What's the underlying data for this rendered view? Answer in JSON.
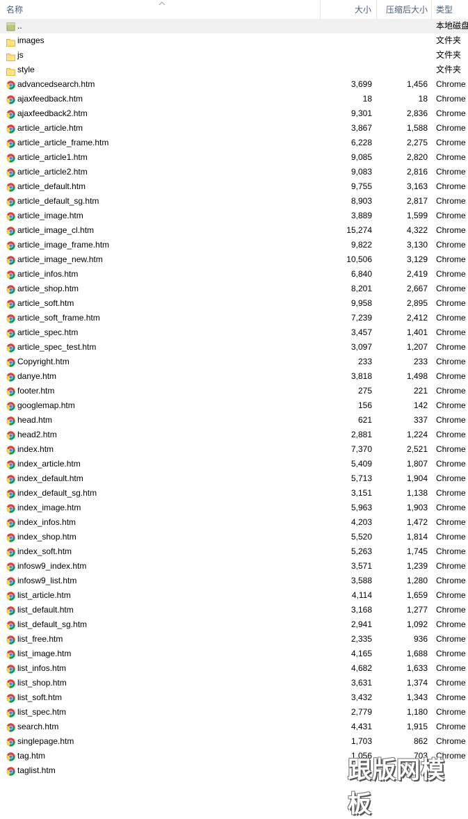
{
  "header": {
    "name": "名称",
    "size": "大小",
    "compressed": "压缩后大小",
    "type": "类型"
  },
  "rows": [
    {
      "kind": "parent",
      "name": "..",
      "size": "",
      "csize": "",
      "type": "本地磁盘"
    },
    {
      "kind": "folder",
      "name": "images",
      "size": "",
      "csize": "",
      "type": "文件夹"
    },
    {
      "kind": "folder",
      "name": "js",
      "size": "",
      "csize": "",
      "type": "文件夹"
    },
    {
      "kind": "folder",
      "name": "style",
      "size": "",
      "csize": "",
      "type": "文件夹"
    },
    {
      "kind": "file",
      "name": "advancedsearch.htm",
      "size": "3,699",
      "csize": "1,456",
      "type": "Chrome"
    },
    {
      "kind": "file",
      "name": "ajaxfeedback.htm",
      "size": "18",
      "csize": "18",
      "type": "Chrome"
    },
    {
      "kind": "file",
      "name": "ajaxfeedback2.htm",
      "size": "9,301",
      "csize": "2,836",
      "type": "Chrome"
    },
    {
      "kind": "file",
      "name": "article_article.htm",
      "size": "3,867",
      "csize": "1,588",
      "type": "Chrome"
    },
    {
      "kind": "file",
      "name": "article_article_frame.htm",
      "size": "6,228",
      "csize": "2,275",
      "type": "Chrome"
    },
    {
      "kind": "file",
      "name": "article_article1.htm",
      "size": "9,085",
      "csize": "2,820",
      "type": "Chrome"
    },
    {
      "kind": "file",
      "name": "article_article2.htm",
      "size": "9,083",
      "csize": "2,816",
      "type": "Chrome"
    },
    {
      "kind": "file",
      "name": "article_default.htm",
      "size": "9,755",
      "csize": "3,163",
      "type": "Chrome"
    },
    {
      "kind": "file",
      "name": "article_default_sg.htm",
      "size": "8,903",
      "csize": "2,817",
      "type": "Chrome"
    },
    {
      "kind": "file",
      "name": "article_image.htm",
      "size": "3,889",
      "csize": "1,599",
      "type": "Chrome"
    },
    {
      "kind": "file",
      "name": "article_image_cl.htm",
      "size": "15,274",
      "csize": "4,322",
      "type": "Chrome"
    },
    {
      "kind": "file",
      "name": "article_image_frame.htm",
      "size": "9,822",
      "csize": "3,130",
      "type": "Chrome"
    },
    {
      "kind": "file",
      "name": "article_image_new.htm",
      "size": "10,506",
      "csize": "3,129",
      "type": "Chrome"
    },
    {
      "kind": "file",
      "name": "article_infos.htm",
      "size": "6,840",
      "csize": "2,419",
      "type": "Chrome"
    },
    {
      "kind": "file",
      "name": "article_shop.htm",
      "size": "8,201",
      "csize": "2,667",
      "type": "Chrome"
    },
    {
      "kind": "file",
      "name": "article_soft.htm",
      "size": "9,958",
      "csize": "2,895",
      "type": "Chrome"
    },
    {
      "kind": "file",
      "name": "article_soft_frame.htm",
      "size": "7,239",
      "csize": "2,412",
      "type": "Chrome"
    },
    {
      "kind": "file",
      "name": "article_spec.htm",
      "size": "3,457",
      "csize": "1,401",
      "type": "Chrome"
    },
    {
      "kind": "file",
      "name": "article_spec_test.htm",
      "size": "3,097",
      "csize": "1,207",
      "type": "Chrome"
    },
    {
      "kind": "file",
      "name": "Copyright.htm",
      "size": "233",
      "csize": "233",
      "type": "Chrome"
    },
    {
      "kind": "file",
      "name": "danye.htm",
      "size": "3,818",
      "csize": "1,498",
      "type": "Chrome"
    },
    {
      "kind": "file",
      "name": "footer.htm",
      "size": "275",
      "csize": "221",
      "type": "Chrome"
    },
    {
      "kind": "file",
      "name": "googlemap.htm",
      "size": "156",
      "csize": "142",
      "type": "Chrome"
    },
    {
      "kind": "file",
      "name": "head.htm",
      "size": "621",
      "csize": "337",
      "type": "Chrome"
    },
    {
      "kind": "file",
      "name": "head2.htm",
      "size": "2,881",
      "csize": "1,224",
      "type": "Chrome"
    },
    {
      "kind": "file",
      "name": "index.htm",
      "size": "7,370",
      "csize": "2,521",
      "type": "Chrome"
    },
    {
      "kind": "file",
      "name": "index_article.htm",
      "size": "5,409",
      "csize": "1,807",
      "type": "Chrome"
    },
    {
      "kind": "file",
      "name": "index_default.htm",
      "size": "5,713",
      "csize": "1,904",
      "type": "Chrome"
    },
    {
      "kind": "file",
      "name": "index_default_sg.htm",
      "size": "3,151",
      "csize": "1,138",
      "type": "Chrome"
    },
    {
      "kind": "file",
      "name": "index_image.htm",
      "size": "5,963",
      "csize": "1,903",
      "type": "Chrome"
    },
    {
      "kind": "file",
      "name": "index_infos.htm",
      "size": "4,203",
      "csize": "1,472",
      "type": "Chrome"
    },
    {
      "kind": "file",
      "name": "index_shop.htm",
      "size": "5,520",
      "csize": "1,814",
      "type": "Chrome"
    },
    {
      "kind": "file",
      "name": "index_soft.htm",
      "size": "5,263",
      "csize": "1,745",
      "type": "Chrome"
    },
    {
      "kind": "file",
      "name": "infosw9_index.htm",
      "size": "3,571",
      "csize": "1,239",
      "type": "Chrome"
    },
    {
      "kind": "file",
      "name": "infosw9_list.htm",
      "size": "3,588",
      "csize": "1,280",
      "type": "Chrome"
    },
    {
      "kind": "file",
      "name": "list_article.htm",
      "size": "4,114",
      "csize": "1,659",
      "type": "Chrome"
    },
    {
      "kind": "file",
      "name": "list_default.htm",
      "size": "3,168",
      "csize": "1,277",
      "type": "Chrome"
    },
    {
      "kind": "file",
      "name": "list_default_sg.htm",
      "size": "2,941",
      "csize": "1,092",
      "type": "Chrome"
    },
    {
      "kind": "file",
      "name": "list_free.htm",
      "size": "2,335",
      "csize": "936",
      "type": "Chrome"
    },
    {
      "kind": "file",
      "name": "list_image.htm",
      "size": "4,165",
      "csize": "1,688",
      "type": "Chrome"
    },
    {
      "kind": "file",
      "name": "list_infos.htm",
      "size": "4,682",
      "csize": "1,633",
      "type": "Chrome"
    },
    {
      "kind": "file",
      "name": "list_shop.htm",
      "size": "3,631",
      "csize": "1,374",
      "type": "Chrome"
    },
    {
      "kind": "file",
      "name": "list_soft.htm",
      "size": "3,432",
      "csize": "1,343",
      "type": "Chrome"
    },
    {
      "kind": "file",
      "name": "list_spec.htm",
      "size": "2,779",
      "csize": "1,180",
      "type": "Chrome"
    },
    {
      "kind": "file",
      "name": "search.htm",
      "size": "4,431",
      "csize": "1,915",
      "type": "Chrome"
    },
    {
      "kind": "file",
      "name": "singlepage.htm",
      "size": "1,703",
      "csize": "862",
      "type": "Chrome"
    },
    {
      "kind": "file",
      "name": "tag.htm",
      "size": "1,056",
      "csize": "703",
      "type": "Chrome"
    },
    {
      "kind": "file",
      "name": "taglist.htm",
      "size": "",
      "csize": "",
      "type": ""
    }
  ],
  "watermark": "跟版网模板"
}
